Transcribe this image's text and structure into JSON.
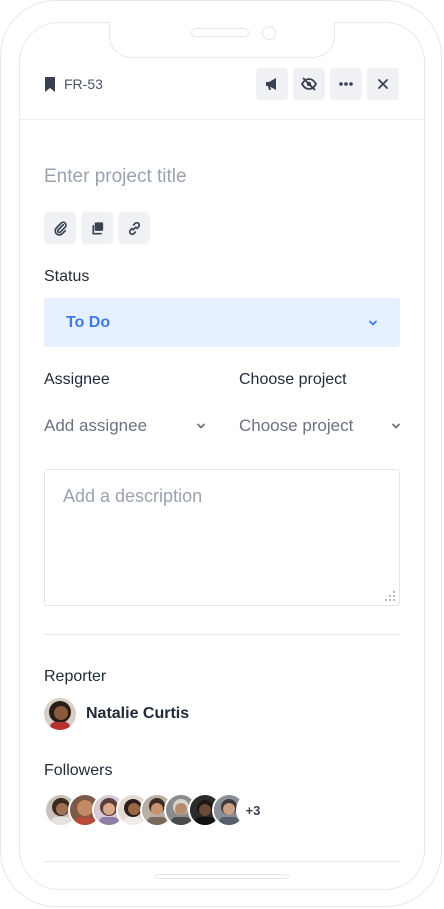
{
  "header": {
    "issue_key": "FR-53",
    "actions": [
      {
        "icon": "megaphone-icon"
      },
      {
        "icon": "eye-off-icon"
      },
      {
        "icon": "more-icon"
      },
      {
        "icon": "close-icon"
      }
    ]
  },
  "title": {
    "placeholder": "Enter project title"
  },
  "quick_actions": [
    {
      "icon": "paperclip-icon"
    },
    {
      "icon": "copy-icon"
    },
    {
      "icon": "link-icon"
    }
  ],
  "status": {
    "label": "Status",
    "value": "To Do"
  },
  "assignee": {
    "label": "Assignee",
    "value": "Add assignee"
  },
  "project": {
    "label": "Choose project",
    "value": "Choose project"
  },
  "description": {
    "placeholder": "Add a description"
  },
  "reporter": {
    "label": "Reporter",
    "name": "Natalie Curtis"
  },
  "followers": {
    "label": "Followers",
    "more": "+3"
  },
  "colors": {
    "accent": "#3d7be8",
    "status_bg": "#e7f0fe",
    "button_bg": "#f0f1f4"
  }
}
